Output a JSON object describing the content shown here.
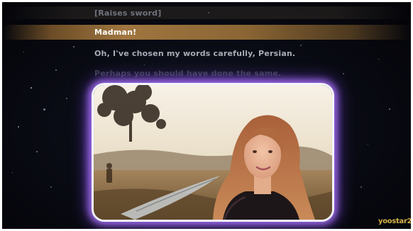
{
  "lyrics": {
    "previous": "[Raises sword]",
    "current": "Madman!",
    "next": "Oh, I've chosen my words carefully, Persian.",
    "upcoming": "Perhaps you should have done the same."
  },
  "logo": {
    "text": "yoostar2"
  },
  "colors": {
    "highlight_bar": "#a07640",
    "frame_glow": "#af78ff",
    "logo": "#d6b24a"
  }
}
